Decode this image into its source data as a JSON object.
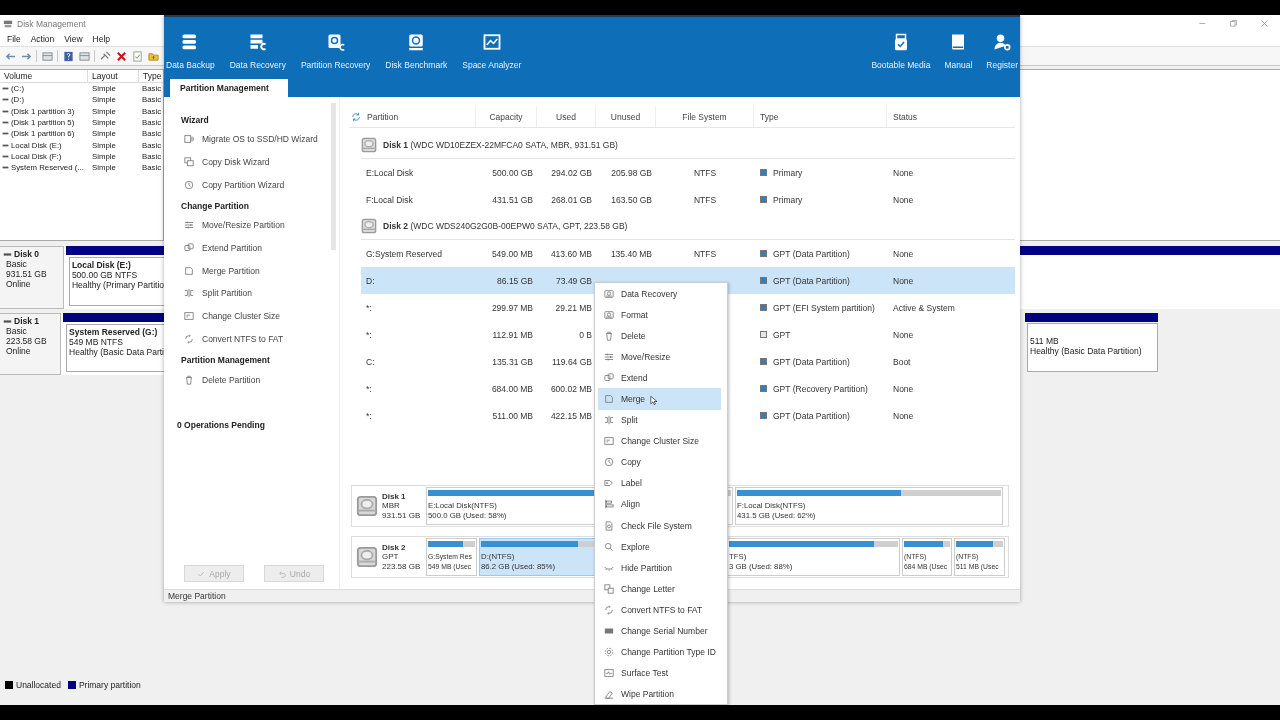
{
  "background_window": {
    "title": "Disk Management",
    "menu": [
      "File",
      "Action",
      "View",
      "Help"
    ],
    "volume_list": {
      "columns": [
        "Volume",
        "Layout",
        "Type"
      ],
      "rows": [
        {
          "volume": "(C:)",
          "layout": "Simple",
          "type": "Basic"
        },
        {
          "volume": "(D:)",
          "layout": "Simple",
          "type": "Basic"
        },
        {
          "volume": "(Disk 1 partition 3)",
          "layout": "Simple",
          "type": "Basic"
        },
        {
          "volume": "(Disk 1 partition 5)",
          "layout": "Simple",
          "type": "Basic"
        },
        {
          "volume": "(Disk 1 partition 6)",
          "layout": "Simple",
          "type": "Basic"
        },
        {
          "volume": "Local Disk (E:)",
          "layout": "Simple",
          "type": "Basic"
        },
        {
          "volume": "Local Disk (F:)",
          "layout": "Simple",
          "type": "Basic"
        },
        {
          "volume": "System Reserved (...",
          "layout": "Simple",
          "type": "Basic"
        }
      ]
    },
    "disks": [
      {
        "name": "Disk 0",
        "kind": "Basic",
        "size": "931.51 GB",
        "status": "Online",
        "partitions": [
          {
            "name": "Local Disk  (E:)",
            "detail": "500.00 GB NTFS",
            "health": "Healthy (Primary Partitio"
          }
        ]
      },
      {
        "name": "Disk 1",
        "kind": "Basic",
        "size": "223.58 GB",
        "status": "Online",
        "partitions": [
          {
            "name": "System Reserved  (G:)",
            "detail": "549 MB NTFS",
            "health": "Healthy (Basic Data Parti"
          }
        ],
        "right_partitions": [
          {
            "detail": "511 MB",
            "health": "Healthy (Basic Data Partition)"
          }
        ]
      }
    ],
    "legend": [
      {
        "label": "Unallocated",
        "color": "#000000"
      },
      {
        "label": "Primary partition",
        "color": "#00007f"
      }
    ]
  },
  "app_window": {
    "toolbar_left": [
      "Data Backup",
      "Data Recovery",
      "Partition Recovery",
      "Disk Benchmark",
      "Space Analyzer"
    ],
    "toolbar_right": [
      "Bootable Media",
      "Manual",
      "Register"
    ],
    "tabs": [
      {
        "label": "Partition Management",
        "selected": true
      }
    ],
    "sidebar": {
      "sections": [
        {
          "title": "Wizard",
          "items": [
            "Migrate OS to SSD/HD Wizard",
            "Copy Disk Wizard",
            "Copy Partition Wizard"
          ]
        },
        {
          "title": "Change Partition",
          "items": [
            "Move/Resize Partition",
            "Extend Partition",
            "Merge Partition",
            "Split Partition",
            "Change Cluster Size",
            "Convert NTFS to FAT"
          ]
        },
        {
          "title": "Partition Management",
          "items": [
            "Delete Partition"
          ]
        }
      ],
      "pending": "0 Operations Pending",
      "buttons": [
        {
          "label": "Apply",
          "disabled": true
        },
        {
          "label": "Undo",
          "disabled": true
        }
      ]
    },
    "table": {
      "columns": [
        "Partition",
        "Capacity",
        "Used",
        "Unused",
        "File System",
        "Type",
        "Status"
      ],
      "groups": [
        {
          "disk": "**Disk 1** (WDC WD10EZEX-22MFCA0 SATA, MBR, 931.51 GB)",
          "rows": [
            {
              "partition": "E:Local Disk",
              "capacity": "500.00 GB",
              "used": "294.02 GB",
              "unused": "205.98 GB",
              "file_system": "NTFS",
              "type": "Primary",
              "color": "#2f7fc1",
              "status": "None",
              "selected": false
            },
            {
              "partition": "F:Local Disk",
              "capacity": "431.51 GB",
              "used": "268.01 GB",
              "unused": "163.50 GB",
              "file_system": "NTFS",
              "type": "Primary",
              "color": "#2f7fc1",
              "status": "None",
              "selected": false
            }
          ]
        },
        {
          "disk": "**Disk 2** (WDC WDS240G2G0B-00EPW0 SATA, GPT, 223.58 GB)",
          "rows": [
            {
              "partition": "G:System Reserved",
              "capacity": "549.00 MB",
              "used": "413.60 MB",
              "unused": "135.40 MB",
              "file_system": "NTFS",
              "type": "GPT (Data Partition)",
              "color": "#2f7fc1",
              "status": "None",
              "selected": false
            },
            {
              "partition": "D:",
              "capacity": "86.15 GB",
              "used": "73.49 GB",
              "type": "GPT (Data Partition)",
              "color": "#2f7fc1",
              "status": "None",
              "selected": true
            },
            {
              "partition": "*:",
              "capacity": "299.97 MB",
              "used": "29.21 MB",
              "type": "GPT (EFI System partition)",
              "color": "#2f7fc1",
              "status": "Active & System",
              "selected": false
            },
            {
              "partition": "*:",
              "capacity": "112.91 MB",
              "used": "0 B",
              "type": "GPT",
              "color": "#e6e6e6",
              "status": "None",
              "selected": false
            },
            {
              "partition": "C:",
              "capacity": "135.31 GB",
              "used": "119.64 GB",
              "type": "GPT (Data Partition)",
              "color": "#2f7fc1",
              "status": "Boot",
              "selected": false
            },
            {
              "partition": "*:",
              "capacity": "684.00 MB",
              "used": "600.02 MB",
              "type": "GPT (Recovery Partition)",
              "color": "#2f7fc1",
              "status": "None",
              "selected": false
            },
            {
              "partition": "*:",
              "capacity": "511.00 MB",
              "used": "422.15 MB",
              "type": "GPT (Data Partition)",
              "color": "#2f7fc1",
              "status": "None",
              "selected": false
            }
          ]
        }
      ]
    },
    "disk_map": [
      {
        "name": "Disk 1",
        "style": "MBR",
        "size": "931.51 GB",
        "partitions": [
          {
            "name": "E:Local Disk(NTFS)",
            "detail": "500.0 GB (Used: 58%)",
            "level": 0.58,
            "selected": false
          },
          {
            "name": "F:Local Disk(NTFS)",
            "detail": "431.5 GB (Used: 62%)",
            "level": 0.62,
            "selected": false
          }
        ]
      },
      {
        "name": "Disk 2",
        "style": "GPT",
        "size": "223.58 GB",
        "partitions": [
          {
            "name": "G:System Res",
            "detail": "549 MB (Usec",
            "level": 0.75,
            "selected": false
          },
          {
            "name": "D:(NTFS)",
            "detail": "86.2 GB (Used: 85%)",
            "level": 0.85,
            "selected": true
          },
          {
            "name": "TFS)",
            "detail": "3 GB (Used: 88%)",
            "level": 0.86,
            "selected": false
          },
          {
            "name": "(NTFS)",
            "detail": "684 MB (Usec",
            "level": 0.84,
            "selected": false
          },
          {
            "name": "(NTFS)",
            "detail": "511 MB (Usec",
            "level": 0.78,
            "selected": false
          }
        ]
      }
    ],
    "status_bar": "Merge Partition"
  },
  "context_menu": {
    "items": [
      {
        "label": "Data Recovery",
        "selected": false
      },
      {
        "label": "Format",
        "selected": false
      },
      {
        "label": "Delete",
        "selected": false
      },
      {
        "label": "Move/Resize",
        "selected": false
      },
      {
        "label": "Extend",
        "selected": false
      },
      {
        "label": "Merge",
        "selected": true
      },
      {
        "label": "Split",
        "selected": false
      },
      {
        "label": "Change Cluster Size",
        "selected": false
      },
      {
        "label": "Copy",
        "selected": false
      },
      {
        "label": "Label",
        "selected": false
      },
      {
        "label": "Align",
        "selected": false
      },
      {
        "label": "Check File System",
        "selected": false
      },
      {
        "label": "Explore",
        "selected": false
      },
      {
        "label": "Hide Partition",
        "selected": false
      },
      {
        "label": "Change Letter",
        "selected": false
      },
      {
        "label": "Convert NTFS to FAT",
        "selected": false
      },
      {
        "label": "Change Serial Number",
        "selected": false
      },
      {
        "label": "Change Partition Type ID",
        "selected": false
      },
      {
        "label": "Surface Test",
        "selected": false
      },
      {
        "label": "Wipe Partition",
        "selected": false
      }
    ]
  }
}
